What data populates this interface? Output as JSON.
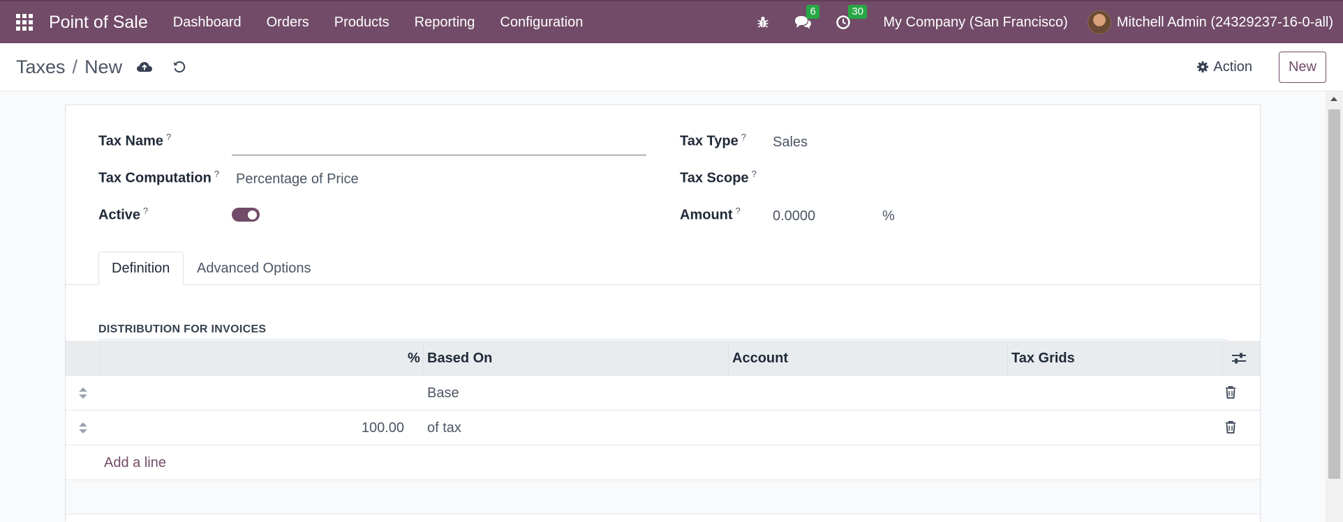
{
  "navbar": {
    "app_name": "Point of Sale",
    "menu": [
      "Dashboard",
      "Orders",
      "Products",
      "Reporting",
      "Configuration"
    ],
    "messages_count": "6",
    "activities_count": "30",
    "company": "My Company (San Francisco)",
    "user": "Mitchell Admin (24329237-16-0-all)",
    "bg_color": "#714b67"
  },
  "control_panel": {
    "breadcrumb_parent": "Taxes",
    "breadcrumb_separator": "/",
    "breadcrumb_current": "New",
    "action_label": "Action",
    "new_label": "New"
  },
  "form": {
    "tax_name_label": "Tax Name",
    "tax_name_value": "",
    "tax_computation_label": "Tax Computation",
    "tax_computation_value": "Percentage of Price",
    "active_label": "Active",
    "active_value": true,
    "tax_type_label": "Tax Type",
    "tax_type_value": "Sales",
    "tax_scope_label": "Tax Scope",
    "tax_scope_value": "",
    "amount_label": "Amount",
    "amount_value": "0.0000",
    "amount_unit": "%",
    "help_marker": "?"
  },
  "tabs": [
    {
      "label": "Definition",
      "active": true
    },
    {
      "label": "Advanced Options",
      "active": false
    }
  ],
  "distribution": {
    "title": "DISTRIBUTION FOR INVOICES",
    "headers": {
      "percent": "%",
      "based_on": "Based On",
      "account": "Account",
      "tax_grids": "Tax Grids"
    },
    "rows": [
      {
        "percent": "",
        "based_on": "Base",
        "account": "",
        "tax_grids": ""
      },
      {
        "percent": "100.00",
        "based_on": "of tax",
        "account": "",
        "tax_grids": ""
      }
    ],
    "add_line_label": "Add a line"
  }
}
